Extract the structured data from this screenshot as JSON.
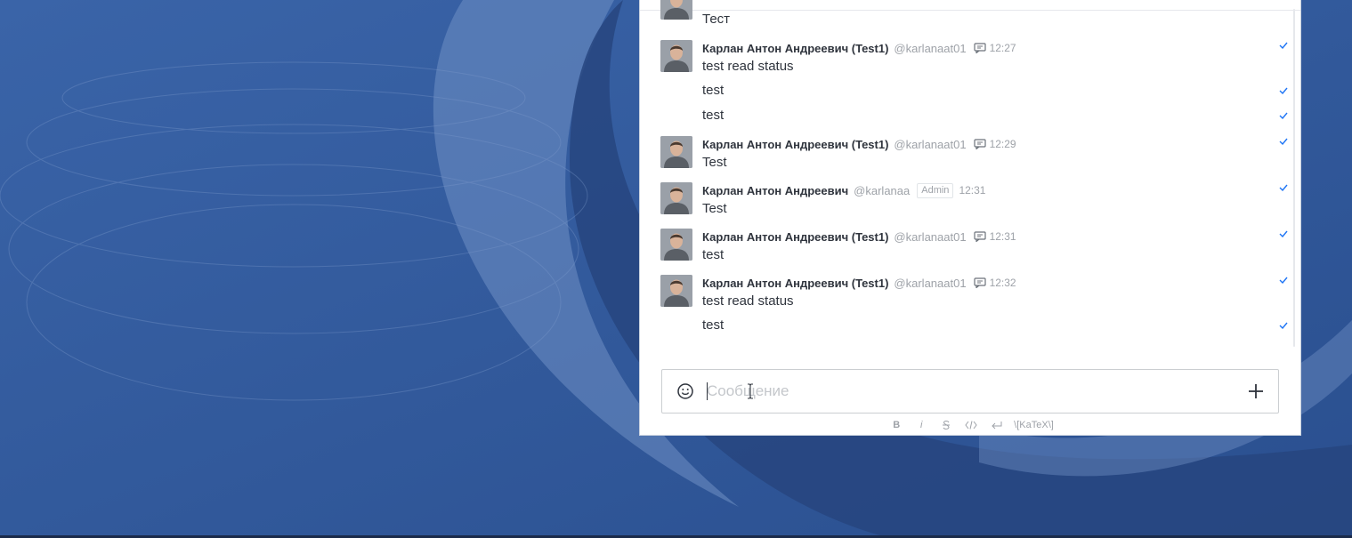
{
  "colors": {
    "desktop_bg": "#2f5596",
    "accent_check": "#1d74f5",
    "text_primary": "#2f343d",
    "text_muted": "#9ea2a8"
  },
  "messages": [
    {
      "body": "Тест"
    },
    {
      "name": "Карлан Антон Андреевич (Test1)",
      "username": "@karlanaat01",
      "thread_icon": "thread-icon",
      "time": "12:27",
      "body": "test read status"
    },
    {
      "body": "test"
    },
    {
      "body": "test"
    },
    {
      "name": "Карлан Антон Андреевич (Test1)",
      "username": "@karlanaat01",
      "thread_icon": "thread-icon",
      "time": "12:29",
      "body": "Test"
    },
    {
      "name": "Карлан Антон Андреевич",
      "username": "@karlanaa",
      "badge": "Admin",
      "time": "12:31",
      "body": "Test"
    },
    {
      "name": "Карлан Антон Андреевич (Test1)",
      "username": "@karlanaat01",
      "thread_icon": "thread-icon",
      "time": "12:31",
      "body": "test"
    },
    {
      "name": "Карлан Антон Андреевич (Test1)",
      "username": "@karlanaat01",
      "thread_icon": "thread-icon",
      "time": "12:32",
      "body": "test read status"
    },
    {
      "body": "test"
    }
  ],
  "composer": {
    "placeholder": "Сообщение",
    "value": "",
    "emoji_icon": "smiley-icon",
    "plus_icon": "plus-icon"
  },
  "format_bar": {
    "bold": "B",
    "italic": "i",
    "katex": "\\[KaTeX\\]"
  }
}
